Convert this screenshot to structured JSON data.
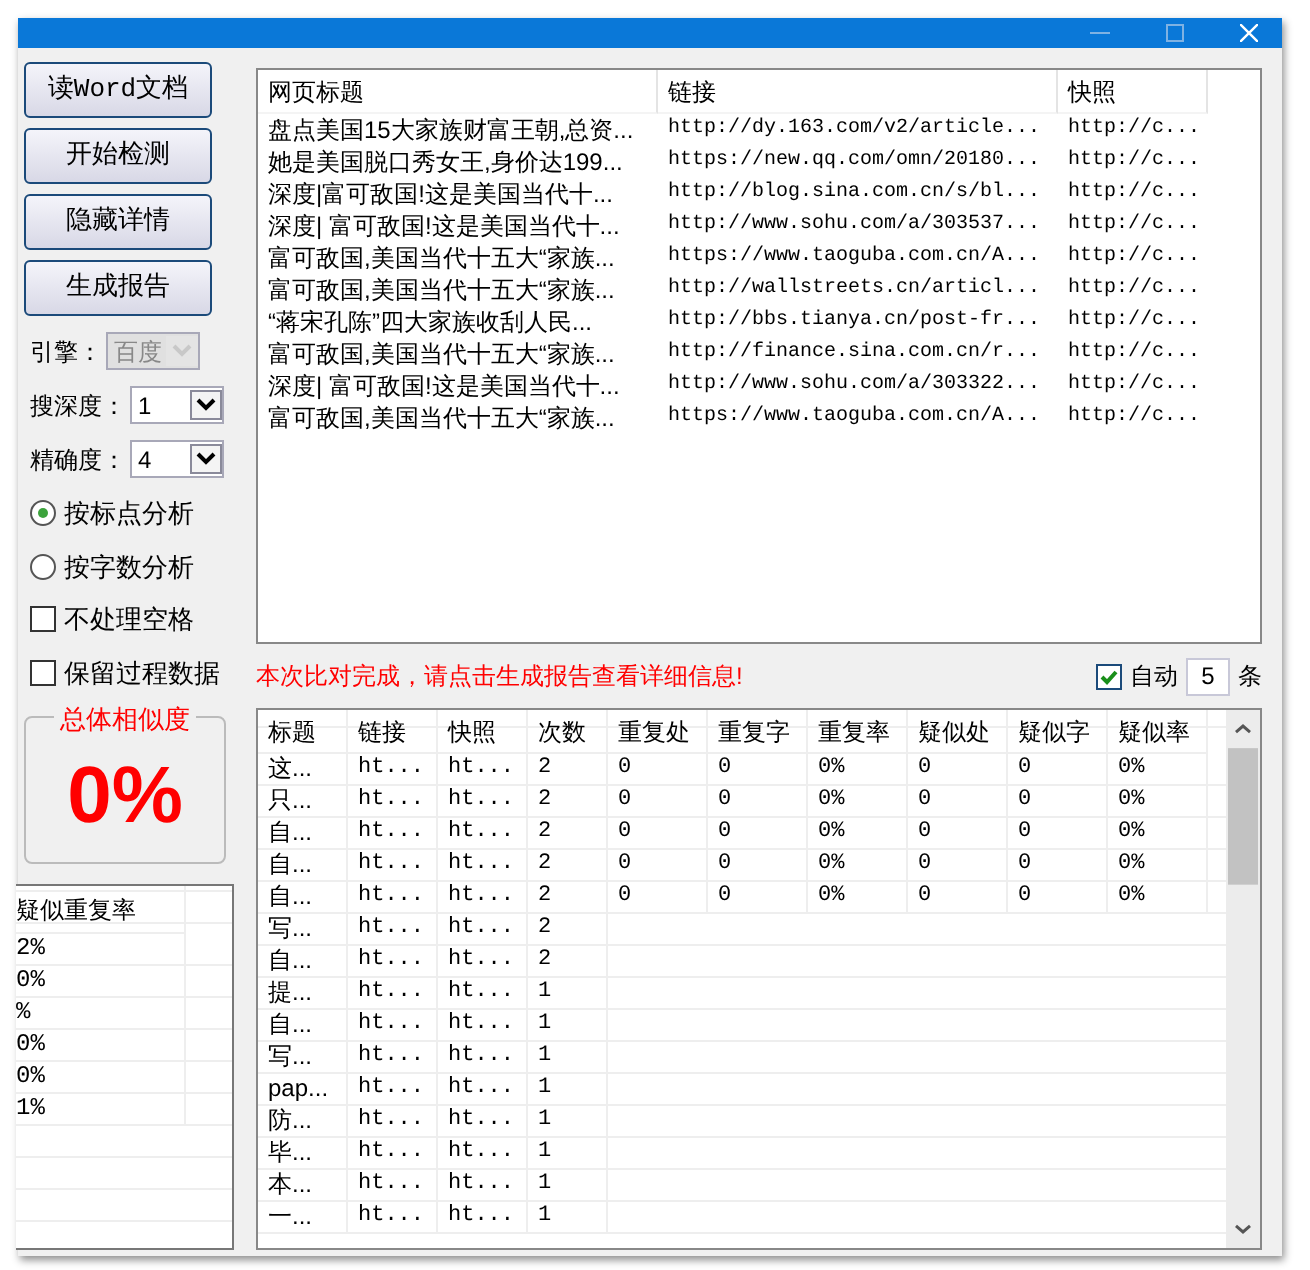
{
  "left_panel": {
    "buttons": [
      "读Word文档",
      "开始检测",
      "隐藏详情",
      "生成报告"
    ],
    "selects": [
      {
        "label": "引擎：",
        "value": "百度",
        "disabled": true
      },
      {
        "label": "搜深度：",
        "value": "1",
        "disabled": false
      },
      {
        "label": "精确度：",
        "value": "4",
        "disabled": false
      }
    ],
    "analysis_modes": [
      {
        "label": "按标点分析",
        "selected": true
      },
      {
        "label": "按字数分析",
        "selected": false
      }
    ],
    "options": [
      {
        "label": "不处理空格",
        "checked": false
      },
      {
        "label": "保留过程数据",
        "checked": false
      }
    ],
    "similarity": {
      "title": "总体相似度",
      "value": "0%"
    }
  },
  "summary_table": {
    "columns": [
      "疑似重复率"
    ],
    "rows": [
      "2%",
      "0%",
      "%",
      "0%",
      "0%",
      "1%"
    ]
  },
  "results_table": {
    "columns": [
      "网页标题",
      "链接",
      "快照"
    ],
    "rows": [
      [
        "盘点美国15大家族财富王朝,总资...",
        "http://dy.163.com/v2/article...",
        "http://c..."
      ],
      [
        "她是美国脱口秀女王,身价达199...",
        "https://new.qq.com/omn/20180...",
        "http://c..."
      ],
      [
        "深度|富可敌国!这是美国当代十...",
        "http://blog.sina.com.cn/s/bl...",
        "http://c..."
      ],
      [
        "深度| 富可敌国!这是美国当代十...",
        "http://www.sohu.com/a/303537...",
        "http://c..."
      ],
      [
        "富可敌国,美国当代十五大“家族...",
        "https://www.taoguba.com.cn/A...",
        "http://c..."
      ],
      [
        "富可敌国,美国当代十五大“家族...",
        "http://wallstreets.cn/articl...",
        "http://c..."
      ],
      [
        "“蒋宋孔陈”四大家族收刮人民...",
        "http://bbs.tianya.cn/post-fr...",
        "http://c..."
      ],
      [
        "富可敌国,美国当代十五大“家族...",
        "http://finance.sina.com.cn/r...",
        "http://c..."
      ],
      [
        "深度| 富可敌国!这是美国当代十...",
        "http://www.sohu.com/a/303322...",
        "http://c..."
      ],
      [
        "富可敌国,美国当代十五大“家族...",
        "https://www.taoguba.com.cn/A...",
        "http://c..."
      ]
    ]
  },
  "status_message": "本次比对完成，请点击生成报告查看详细信息!",
  "auto": {
    "checked": true,
    "label": "自动",
    "count": "5",
    "unit": "条"
  },
  "detail_table": {
    "columns": [
      "标题",
      "链接",
      "快照",
      "次数",
      "重复处",
      "重复字",
      "重复率",
      "疑似处",
      "疑似字",
      "疑似率"
    ],
    "rows": [
      [
        "这...",
        "ht...",
        "ht...",
        "2",
        "0",
        "0",
        "0%",
        "0",
        "0",
        "0%"
      ],
      [
        "只...",
        "ht...",
        "ht...",
        "2",
        "0",
        "0",
        "0%",
        "0",
        "0",
        "0%"
      ],
      [
        "自...",
        "ht...",
        "ht...",
        "2",
        "0",
        "0",
        "0%",
        "0",
        "0",
        "0%"
      ],
      [
        "自...",
        "ht...",
        "ht...",
        "2",
        "0",
        "0",
        "0%",
        "0",
        "0",
        "0%"
      ],
      [
        "自...",
        "ht...",
        "ht...",
        "2",
        "0",
        "0",
        "0%",
        "0",
        "0",
        "0%"
      ],
      [
        "写...",
        "ht...",
        "ht...",
        "2"
      ],
      [
        "自...",
        "ht...",
        "ht...",
        "2"
      ],
      [
        "提...",
        "ht...",
        "ht...",
        "1"
      ],
      [
        "自...",
        "ht...",
        "ht...",
        "1"
      ],
      [
        "写...",
        "ht...",
        "ht...",
        "1"
      ],
      [
        "pap...",
        "ht...",
        "ht...",
        "1"
      ],
      [
        "防...",
        "ht...",
        "ht...",
        "1"
      ],
      [
        "毕...",
        "ht...",
        "ht...",
        "1"
      ],
      [
        "本...",
        "ht...",
        "ht...",
        "1"
      ],
      [
        "一...",
        "ht...",
        "ht...",
        "1"
      ]
    ]
  }
}
